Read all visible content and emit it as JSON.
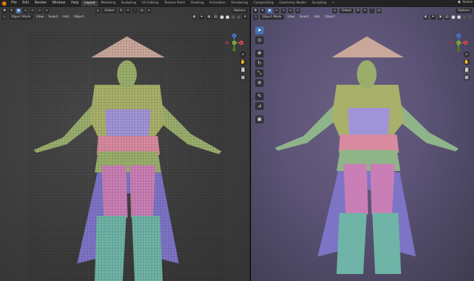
{
  "topbar": {
    "menus": [
      "File",
      "Edit",
      "Render",
      "Window",
      "Help"
    ],
    "workspaces": [
      {
        "label": "Layout",
        "active": true
      },
      {
        "label": "Modeling",
        "active": false
      },
      {
        "label": "Sculpting",
        "active": false
      },
      {
        "label": "UV Editing",
        "active": false
      },
      {
        "label": "Texture Paint",
        "active": false
      },
      {
        "label": "Shading",
        "active": false
      },
      {
        "label": "Animation",
        "active": false
      },
      {
        "label": "Rendering",
        "active": false
      },
      {
        "label": "Compositing",
        "active": false
      },
      {
        "label": "Geometry Nodes",
        "active": false
      },
      {
        "label": "Scripting",
        "active": false
      }
    ],
    "add_tab": "+",
    "scene_label": "Scene"
  },
  "left_viewport": {
    "orientation": "Global",
    "options_label": "Options",
    "mode_label": "Object Mode",
    "menus": [
      "View",
      "Select",
      "Add",
      "Object"
    ]
  },
  "right_viewport": {
    "orientation": "Global",
    "options_label": "Options",
    "mode_label": "Object Mode",
    "menus": [
      "View",
      "Select",
      "Add",
      "Object"
    ]
  },
  "gizmo_axes": {
    "x": "X",
    "y": "Y",
    "z": "Z"
  },
  "colors": {
    "accent": "#4772b3",
    "axis_x": "#e24b5a",
    "axis_y": "#7fbf2e",
    "axis_z": "#3f83e6",
    "hat": "#c9a79a",
    "skin": "#9aae6c",
    "wrap": "#a8b06a",
    "torso_band": "#9f94d6",
    "belt": "#d98aa0",
    "pants": "#c97fb5",
    "cape": "#7e74c6",
    "boots": "#6fb4a6"
  }
}
